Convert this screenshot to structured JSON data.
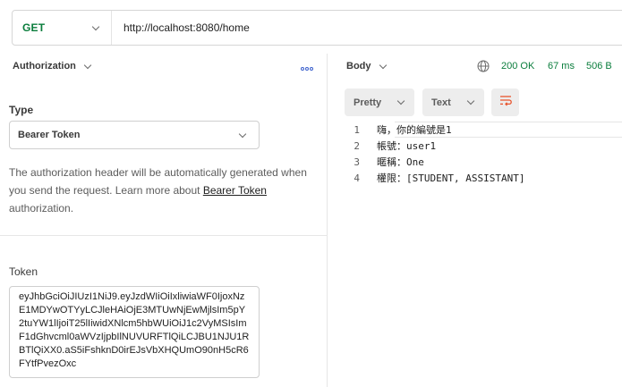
{
  "request": {
    "method": "GET",
    "url": "http://localhost:8080/home"
  },
  "auth": {
    "header": "Authorization",
    "type_label": "Type",
    "type_value": "Bearer Token",
    "description_before": "The authorization header will be automatically generated when you send the request. Learn more about ",
    "description_link": "Bearer Token",
    "description_after": " authorization.",
    "token_label": "Token",
    "token_value": "eyJhbGciOiJIUzI1NiJ9.eyJzdWIiOiIxliwiaWF0IjoxNzE1MDYwOTYyLCJleHAiOjE3MTUwNjEwMjlsIm5pY2tuYW1lIjoiT25lIiwidXNlcm5hbWUiOiJ1c2VyMSIsImF1dGhvcml0aWVzIjpbIlNUVURFTlQiLCJBU1NJU1RBTlQiXX0.aS5iFshknD0irEJsVbXHQUmO90nH5cR6FYtfPvezOxc"
  },
  "response": {
    "body_label": "Body",
    "status": "200 OK",
    "time": "67 ms",
    "size": "506 B",
    "pretty_label": "Pretty",
    "text_label": "Text",
    "lines": [
      {
        "n": "1",
        "text": "嗨，你的編號是1"
      },
      {
        "n": "2",
        "text": "帳號：user1"
      },
      {
        "n": "3",
        "text": "暱稱：One"
      },
      {
        "n": "4",
        "text": "權限：[STUDENT, ASSISTANT]"
      }
    ]
  },
  "colors": {
    "method_green": "#0a7d3c",
    "status_green": "#0a7d3c",
    "accent_blue": "#3a5fcd",
    "wrap_orange": "#e8542d"
  }
}
